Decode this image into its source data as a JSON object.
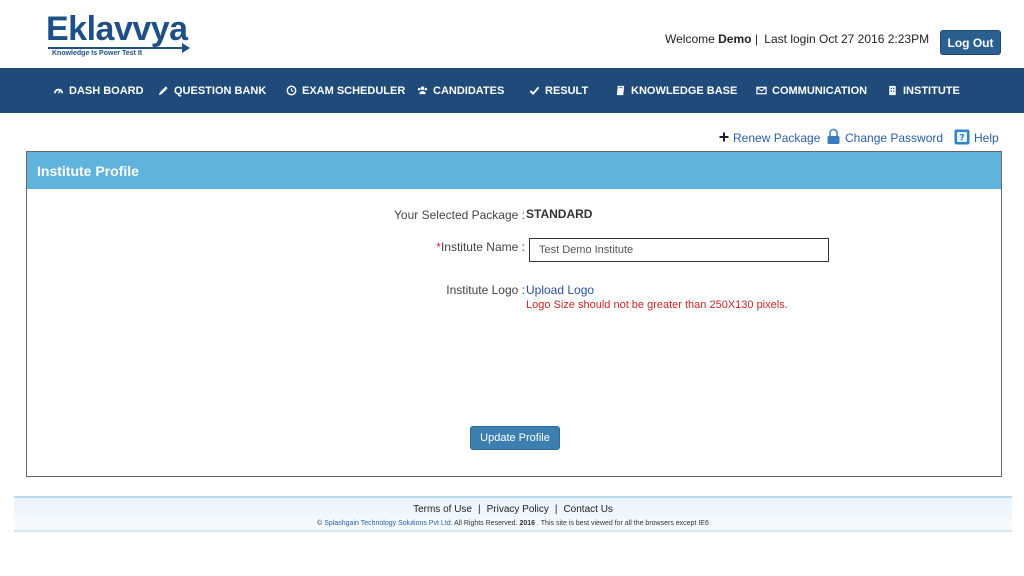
{
  "brand": {
    "name": "Eklavvya",
    "tagline": "Knowledge Is Power Test It",
    "color": "#1f4f87"
  },
  "header": {
    "welcome_prefix": "Welcome",
    "user": "Demo",
    "separator": "|",
    "last_login": "Last login Oct 27 2016 2:23PM",
    "logout_label": "Log Out"
  },
  "nav": {
    "items": [
      {
        "label": "DASH BOARD",
        "icon": "dashboard-icon"
      },
      {
        "label": "QUESTION BANK",
        "icon": "pencil-icon"
      },
      {
        "label": "EXAM SCHEDULER",
        "icon": "clock-icon"
      },
      {
        "label": "CANDIDATES",
        "icon": "users-icon"
      },
      {
        "label": "RESULT",
        "icon": "check-icon"
      },
      {
        "label": "KNOWLEDGE BASE",
        "icon": "book-icon"
      },
      {
        "label": "COMMUNICATION",
        "icon": "envelope-icon"
      },
      {
        "label": "INSTITUTE",
        "icon": "building-icon"
      }
    ]
  },
  "tools": {
    "renew": "Renew Package",
    "change_password": "Change Password",
    "help": "Help"
  },
  "panel": {
    "title": "Institute Profile",
    "package_label": "Your Selected Package :",
    "package_value": "STANDARD",
    "required_mark": "*",
    "name_label": "Institute Name :",
    "name_value": "Test Demo Institute",
    "logo_label": "Institute Logo :",
    "upload_link": "Upload Logo",
    "logo_hint": "Logo Size should not be greater than 250X130 pixels.",
    "update_label": "Update Profile"
  },
  "footer": {
    "terms": "Terms of Use",
    "privacy": "Privacy Policy",
    "contact": "Contact Us",
    "sep": "|",
    "copy_symbol": "©",
    "company": "Splashgain Technology Solutions Pvt Ltd.",
    "rights": "All Rights Reserved.",
    "year": "2016",
    "browser_note": ". This site is best viewed for all the browsers except IE6"
  },
  "colors": {
    "nav_bg": "#1f4a7a",
    "panel_head": "#5fb3dd",
    "button": "#3d7fb0",
    "error": "#c62828"
  }
}
